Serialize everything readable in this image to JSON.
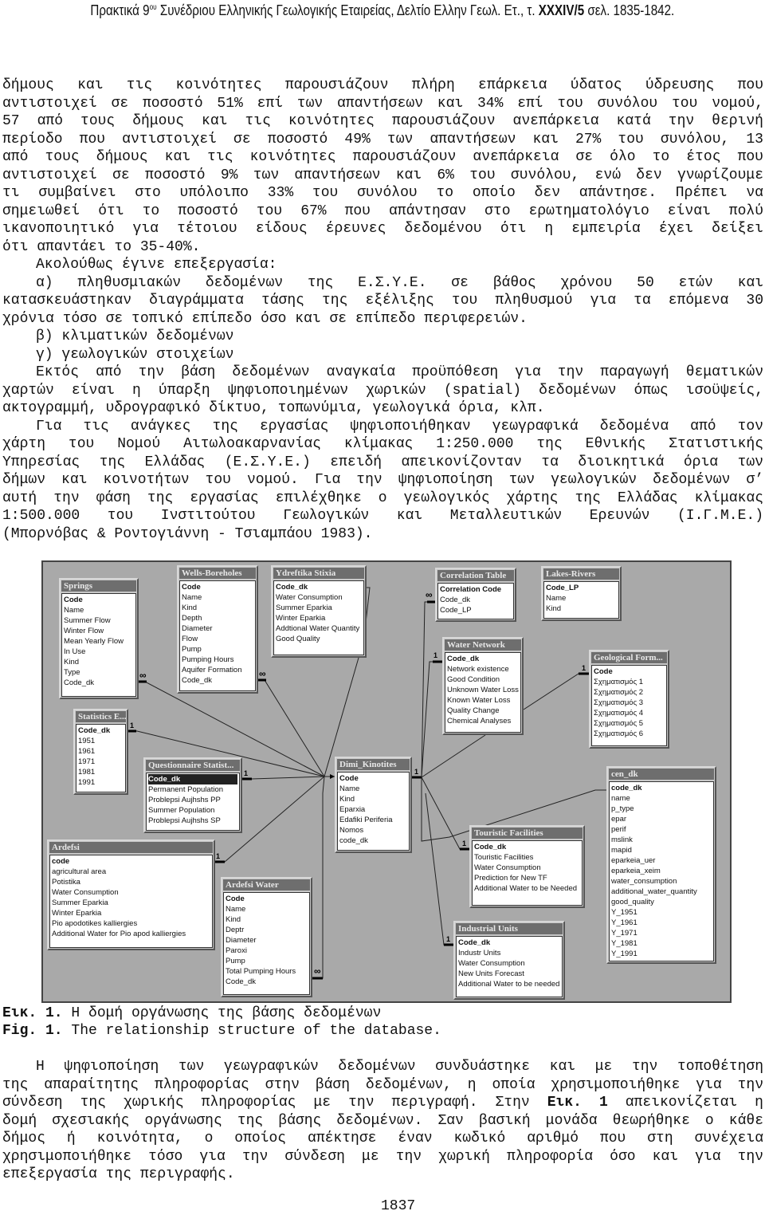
{
  "header": {
    "pre": "Πρακτικά 9",
    "sup": "ου",
    "mid": " Συνέδριου Ελληνικής Γεωλογικής Εταιρείας, Δελτίο Ελλην Γεωλ. Ετ., τ. ",
    "bold": "XXXIV/5",
    "post": " σελ. 1835-1842."
  },
  "body_lines": [
    {
      "t": "δήμους και τις κοινότητες παρουσιάζουν πλήρη επάρκεια ύδατος ύδρευσης που",
      "j": true
    },
    {
      "t": "αντιστοιχεί σε ποσοστό 51% επί των απαντήσεων και 34% επί του συνόλου του νομού,",
      "j": true
    },
    {
      "t": "57 από τους δήμους και τις κοινότητες παρουσιάζουν ανεπάρκεια κατά την θερινή",
      "j": true
    },
    {
      "t": "περίοδο που αντιστοιχεί σε ποσοστό 49% των απαντήσεων και 27% του συνόλου, 13",
      "j": true
    },
    {
      "t": "από τους δήμους και τις κοινότητες παρουσιάζουν ανεπάρκεια σε όλο το έτος που",
      "j": true
    },
    {
      "t": "αντιστοιχεί σε ποσοστό 9% των απαντήσεων και 6% του συνόλου, ενώ δεν γνωρίζουμε",
      "j": true
    },
    {
      "t": "τι συμβαίνει στο υπόλοιπο 33% του συνόλου το οποίο δεν απάντησε. Πρέπει να",
      "j": true
    },
    {
      "t": "σημειωθεί ότι το ποσοστό του 67% που απάντησαν στο ερωτηματολόγιο είναι πολύ",
      "j": true
    },
    {
      "t": "ικανοποιητικό για τέτοιου είδους έρευνες δεδομένου ότι η εμπειρία έχει δείξει",
      "j": true
    },
    {
      "t": "ότι απαντάει το 35-40%.",
      "j": false
    },
    {
      "t": "Ακολούθως έγινε επεξεργασία:",
      "j": false,
      "ind": true
    },
    {
      "t": "α) πληθυσμιακών δεδομένων της Ε.Σ.Υ.Ε. σε βάθος χρόνου 50 ετών και",
      "j": true,
      "ind": true
    },
    {
      "t": "κατασκευάστηκαν διαγράμματα τάσης της εξέλιξης του πληθυσμού για τα επόμενα 30",
      "j": true
    },
    {
      "t": "χρόνια τόσο σε τοπικό επίπεδο όσο και σε επίπεδο περιφερειών.",
      "j": false
    },
    {
      "t": "β) κλιματικών δεδομένων",
      "j": false,
      "ind": true
    },
    {
      "t": "γ) γεωλογικών στοιχείων",
      "j": false,
      "ind": true
    },
    {
      "t": "Εκτός από την βάση δεδομένων αναγκαία προϋπόθεση για την παραγωγή θεματικών",
      "j": true,
      "ind": true
    },
    {
      "t": "χαρτών είναι η ύπαρξη ψηφιοποιημένων χωρικών (spatial) δεδομένων όπως ισοϋψείς,",
      "j": true
    },
    {
      "t": "ακτογραμμή, υδρογραφικό δίκτυο, τοπωνύμια, γεωλογικά όρια, κλπ.",
      "j": false
    },
    {
      "t": "Για τις ανάγκες της εργασίας ψηφιοποιήθηκαν γεωγραφικά δεδομένα από τον",
      "j": true,
      "ind": true
    },
    {
      "t": "χάρτη του Νομού Αιτωλοακαρνανίας κλίμακας 1:250.000 της Εθνικής Στατιστικής",
      "j": true
    },
    {
      "t": "Υπηρεσίας της Ελλάδας (Ε.Σ.Υ.Ε.) επειδή απεικονίζονταν τα διοικητικά όρια των",
      "j": true
    },
    {
      "t": "δήμων και κοινοτήτων του νομού. Για την ψηφιοποίηση των γεωλογικών δεδομένων σ’",
      "j": true
    },
    {
      "t": "αυτή την φάση της εργασίας επιλέχθηκε ο γεωλογικός χάρτης της Ελλάδας κλίμακας",
      "j": true
    },
    {
      "t": "1:500.000 του Ινστιτούτου Γεωλογικών και Μεταλλευτικών Ερευνών (Ι.Γ.Μ.Ε.)",
      "j": true
    },
    {
      "t": "(Μπορνόβας & Ροντογιάννη - Τσιαμπάου 1983).",
      "j": false
    }
  ],
  "diagram": {
    "tables": [
      {
        "title": "Springs",
        "fields": [
          "Code",
          "Name",
          "Summer Flow",
          "Winter Flow",
          "Mean Yearly Flow",
          "In Use",
          "Kind",
          "Type",
          "Code_dk"
        ]
      },
      {
        "title": "Wells-Boreholes",
        "fields": [
          "Code",
          "Name",
          "Kind",
          "Depth",
          "Diameter",
          "Flow",
          "Pump",
          "Pumping Hours",
          "Aquifer Formation",
          "Code_dk"
        ]
      },
      {
        "title": "Ydreftika Stixia",
        "fields": [
          "Code_dk",
          "Water Consumption",
          "Summer Eparkia",
          "Winter Eparkia",
          "Addtional Water Quantity",
          "Good Quality"
        ]
      },
      {
        "title": "Statistics E...",
        "fields": [
          "Code_dk",
          "1951",
          "1961",
          "1971",
          "1981",
          "1991"
        ]
      },
      {
        "title": "Questionnaire Statist...",
        "fields": [
          "Code_dk",
          "Permanent Population",
          "Problepsi Aujhshs PP",
          "Summer Population",
          "Problepsi Aujhshs SP"
        ]
      },
      {
        "title": "Dimi_Kinotites",
        "fields": [
          "Code",
          "Name",
          "Kind",
          "Eparxia",
          "Edafiki Periferia",
          "Nomos",
          "code_dk"
        ]
      },
      {
        "title": "Ardefsi",
        "fields": [
          "code",
          "agricultural area",
          "Potistika",
          "Water Consumption",
          "Summer Eparkia",
          "Winter Eparkia",
          "Pio apodotikes kalliergies",
          "Additional Water for Pio apod kalliergies"
        ]
      },
      {
        "title": "Ardefsi Water",
        "fields": [
          "Code",
          "Name",
          "Kind",
          "Deptr",
          "Diameter",
          "Paroxi",
          "Pump",
          "Total Pumping Hours",
          "Code_dk"
        ]
      },
      {
        "title": "Correlation Table",
        "fields": [
          "Correlation Code",
          "Code_dk",
          "Code_LP"
        ]
      },
      {
        "title": "Lakes-Rivers",
        "fields": [
          "Code_LP",
          "Name",
          "Kind"
        ]
      },
      {
        "title": "Water Network",
        "fields": [
          "Code_dk",
          "Network existence",
          "Good Condition",
          "Unknown Water Loss",
          "Known Water Loss",
          "Quality Change",
          "Chemical Analyses"
        ]
      },
      {
        "title": "Geological Form...",
        "fields": [
          "Code",
          "Σχηματισμός 1",
          "Σχηματισμός 2",
          "Σχηματισμός 3",
          "Σχηματισμός 4",
          "Σχηματισμός 5",
          "Σχηματισμός 6"
        ]
      },
      {
        "title": "cen_dk",
        "fields": [
          "code_dk",
          "name",
          "p_type",
          "epar",
          "perif",
          "mslink",
          "mapid",
          "eparkeia_uer",
          "eparkeia_xeim",
          "water_consumption",
          "additional_water_quantity",
          "good_quality",
          "Y_1951",
          "Y_1961",
          "Y_1971",
          "Y_1981",
          "Y_1991"
        ]
      },
      {
        "title": "Touristic Facilities",
        "fields": [
          "Code_dk",
          "Touristic Facilities",
          "Water Consumption",
          "Prediction for New TF",
          "Additional Water to be Needed"
        ]
      },
      {
        "title": "Industrial Units",
        "fields": [
          "Code_dk",
          "Industr Units",
          "Water Consumption",
          "New Units Forecast",
          "Additional Water to be needed"
        ]
      }
    ],
    "one_label": "1",
    "many_label": "∞"
  },
  "caption_gr": {
    "label": "Εικ. 1.",
    "text": " Η δομή οργάνωσης της βάσης δεδομένων"
  },
  "caption_en": {
    "label": "Fig. 1.",
    "text": " The relationship structure of the database."
  },
  "final_lines": [
    {
      "t": "Η ψηφιοποίηση των γεωγραφικών δεδομένων συνδυάστηκε και με την τοποθέτηση",
      "j": true,
      "ind": true
    },
    {
      "t": "της απαραίτητης πληροφορίας στην βάση δεδομένων, η οποία χρησιμοποιήθηκε για την",
      "j": true
    },
    {
      "t": "σύνδεση της χωρικής πληροφορίας με την περιγραφή. Στην ",
      "b": "Εικ. 1",
      "p": " απεικονίζεται η",
      "j": true
    },
    {
      "t": "δομή σχεσιακής οργάνωσης της βάσης δεδομένων. Σαν βασική μονάδα θεωρήθηκε ο κάθε",
      "j": true
    },
    {
      "t": "δήμος ή κοινότητα, ο οποίος απέκτησε έναν κωδικό αριθμό που στη συνέχεια",
      "j": true
    },
    {
      "t": "χρησιμοποιήθηκε τόσο για την σύνδεση με την χωρική πληροφορία όσο και για την",
      "j": true
    },
    {
      "t": "επεξεργασία της περιγραφής.",
      "j": false
    }
  ],
  "page_number": "1837"
}
